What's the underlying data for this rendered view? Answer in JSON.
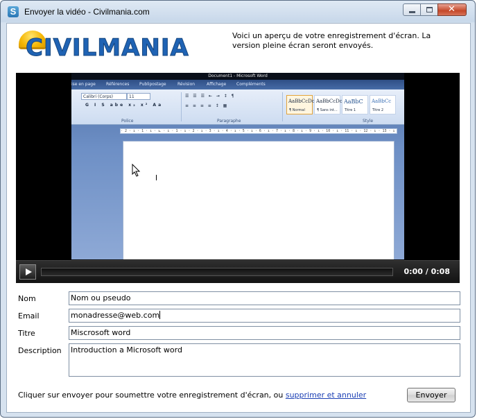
{
  "window": {
    "title": "Envoyer la vidéo - Civilmania.com",
    "icon_letter": "S",
    "close_glyph": "✕"
  },
  "logo": {
    "text": "CIVILMANIA",
    "colors": {
      "text": "#1f63b4",
      "helmet": "#f4b400"
    }
  },
  "preview_note": "Voici un aperçu de votre enregistrement d'écran. La version pleine écran seront envoyés.",
  "video": {
    "word": {
      "title": "Document1 - Microsoft Word",
      "tabs": [
        "ise en page",
        "Références",
        "Publipostage",
        "Révision",
        "Affichage",
        "Compléments"
      ],
      "font_name": "Calibri (Corps)",
      "font_size": "11",
      "group_font": "Police",
      "group_paragraph": "Paragraphe",
      "group_style": "Style",
      "styles": [
        {
          "sample": "AaBbCcDc",
          "name": "¶ Normal"
        },
        {
          "sample": "AaBbCcDc",
          "name": "¶ Sans int..."
        },
        {
          "sample": "AaBbC",
          "name": "Titre 1"
        },
        {
          "sample": "AaBbCc",
          "name": "Titre 2"
        }
      ],
      "ruler": "· 2 · ı · 1 · ı · ⊾ · ı · 1 · ı · 2 · ı · 3 · ı · 4 · ı · 5 · ı · 6 · ı · 7 · ı · 8 · ı · 9 · ı · 10 · ı · 11 · ı · 12 · ı · 13 · ı · 14 · ı · 15 · ı · ⊿ · 17 · ı · 18 ·"
    },
    "time_current": "0:00",
    "time_separator": "/",
    "time_total": "0:08",
    "progress": 0
  },
  "form": {
    "nom": {
      "label": "Nom",
      "value": "Nom ou pseudo"
    },
    "email": {
      "label": "Email",
      "value": "monadresse@web.com"
    },
    "titre": {
      "label": "Titre",
      "value": "Miscrosoft word"
    },
    "description": {
      "label": "Description",
      "value": "Introduction a Microsoft word"
    }
  },
  "footer": {
    "text": "Cliquer sur envoyer pour soumettre votre enregistrement d'écran, ou",
    "link": "supprimer et annuler",
    "send_button": "Envoyer"
  }
}
